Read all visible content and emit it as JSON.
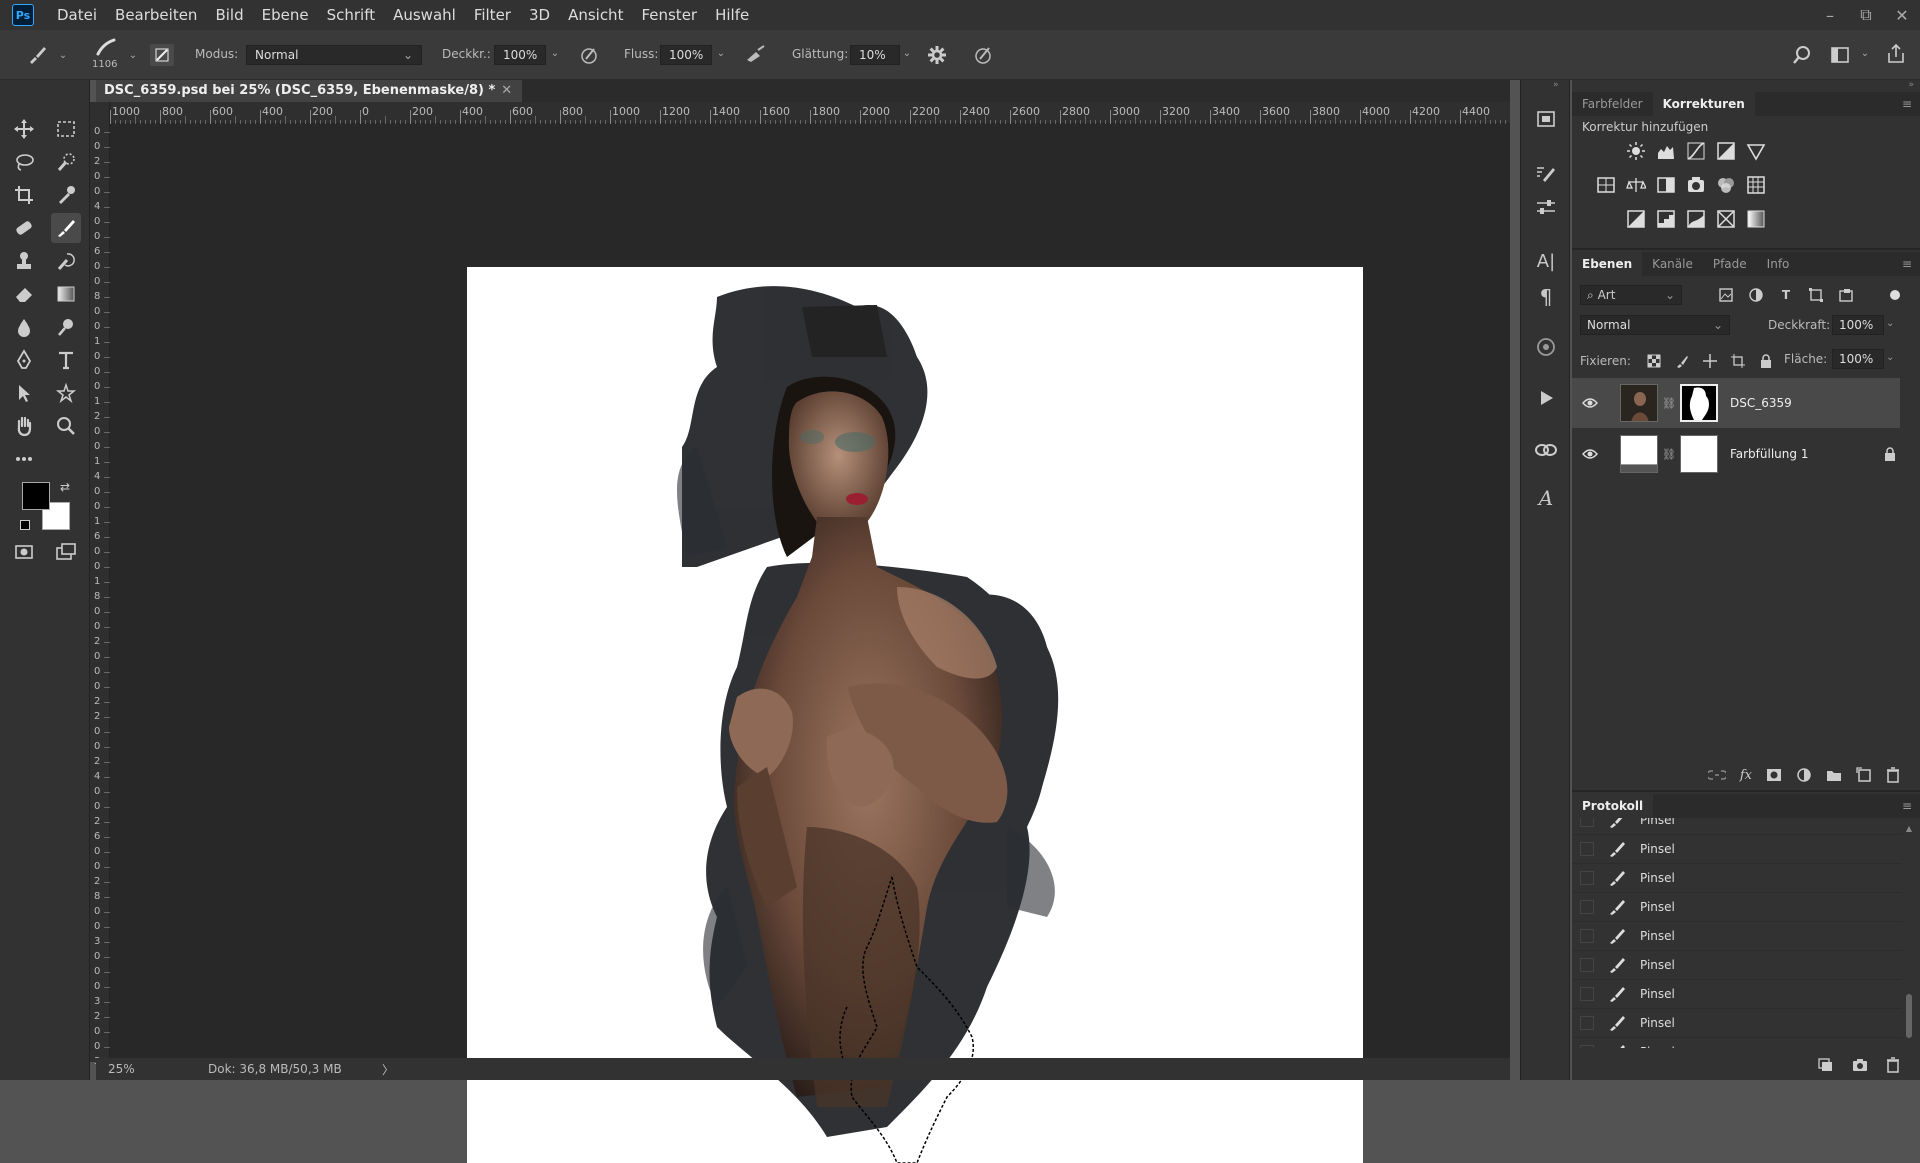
{
  "app": {
    "logo": "Ps"
  },
  "menu": [
    "Datei",
    "Bearbeiten",
    "Bild",
    "Ebene",
    "Schrift",
    "Auswahl",
    "Filter",
    "3D",
    "Ansicht",
    "Fenster",
    "Hilfe"
  ],
  "window_controls": {
    "minimize": "–",
    "restore": "⧉",
    "close": "✕"
  },
  "options": {
    "brush_size": "1106",
    "mode_label": "Modus:",
    "mode_value": "Normal",
    "opacity_label": "Deckkr.:",
    "opacity_value": "100%",
    "flow_label": "Fluss:",
    "flow_value": "100%",
    "smoothing_label": "Glättung:",
    "smoothing_value": "10%"
  },
  "document": {
    "tab_title": "DSC_6359.psd bei 25% (DSC_6359, Ebenenmaske/8) *",
    "close": "✕"
  },
  "ruler": {
    "h_ticks": [
      "1000",
      "800",
      "600",
      "400",
      "200",
      "0",
      "200",
      "400",
      "600",
      "800",
      "1000",
      "1200",
      "1400",
      "1600",
      "1800",
      "2000",
      "2200",
      "2400",
      "2600",
      "2800",
      "3000",
      "3200",
      "3400",
      "3600",
      "3800",
      "4000",
      "4200",
      "4400"
    ],
    "v_ticks": [
      "0",
      "0",
      "2",
      "0",
      "0",
      "4",
      "0",
      "0",
      "6",
      "0",
      "0",
      "8",
      "0",
      "0",
      "1",
      "0",
      "0",
      "0",
      "1",
      "2",
      "0",
      "0",
      "1",
      "4",
      "0",
      "0",
      "1",
      "6",
      "0",
      "0",
      "1",
      "8",
      "0",
      "0",
      "2",
      "0",
      "0",
      "0",
      "2",
      "2",
      "0",
      "0",
      "2",
      "4",
      "0",
      "0",
      "2",
      "6",
      "0",
      "0",
      "2",
      "8",
      "0",
      "0",
      "3",
      "0",
      "0",
      "0",
      "3",
      "2",
      "0",
      "0",
      "3"
    ]
  },
  "status": {
    "zoom": "25%",
    "doc_size": "Dok: 36,8 MB/50,3 MB",
    "arrow": "〉"
  },
  "adjustments_panel": {
    "tabs": [
      "Farbfelder",
      "Korrekturen"
    ],
    "active_tab": "Korrekturen",
    "heading": "Korrektur hinzufügen"
  },
  "layers_panel": {
    "tabs": [
      "Ebenen",
      "Kanäle",
      "Pfade",
      "Info"
    ],
    "active_tab": "Ebenen",
    "filter_label": "Art",
    "blend_mode": "Normal",
    "opacity_label": "Deckkraft:",
    "opacity_value": "100%",
    "lock_label": "Fixieren:",
    "fill_label": "Fläche:",
    "fill_value": "100%",
    "layers": [
      {
        "name": "DSC_6359",
        "selected": true
      },
      {
        "name": "Farbfüllung 1",
        "selected": false,
        "locked": true
      }
    ]
  },
  "history_panel": {
    "title": "Protokoll",
    "items": [
      "Pinsel",
      "Pinsel",
      "Pinsel",
      "Pinsel",
      "Pinsel",
      "Pinsel",
      "Pinsel",
      "Pinsel",
      "Pinsel",
      "Pinsel",
      "Pinsel"
    ],
    "selected_index": 10
  },
  "colors": {
    "accent": "#31a8ff",
    "foreground": "#000000",
    "background": "#ffffff",
    "panel_bg": "#323232",
    "workspace_bg": "#282828"
  }
}
